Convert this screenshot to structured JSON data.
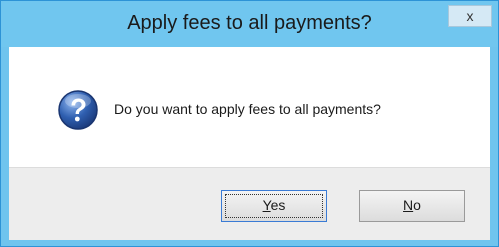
{
  "window": {
    "title": "Apply fees to all payments?",
    "close_glyph": "x"
  },
  "message": {
    "text": "Do you want to apply fees to all payments?",
    "icon": "question-icon"
  },
  "buttons": {
    "yes": {
      "mnemonic": "Y",
      "rest": "es"
    },
    "no": {
      "mnemonic": "N",
      "rest": "o"
    }
  },
  "colors": {
    "titlebar": "#70c6ef",
    "icon_blue": "#2f5fb0"
  }
}
